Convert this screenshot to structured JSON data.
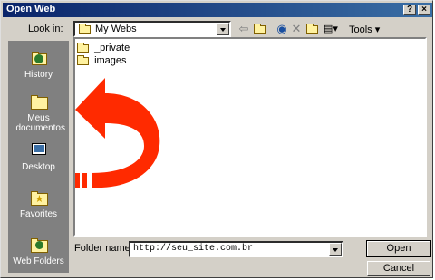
{
  "window": {
    "title": "Open Web",
    "help_label": "?",
    "close_label": "×"
  },
  "lookin": {
    "label": "Look in:",
    "value": "My Webs"
  },
  "toolbar": {
    "tools_label": "Tools ▾"
  },
  "places": [
    {
      "label": "History",
      "icon": "history-icon"
    },
    {
      "label": "Meus documentos",
      "icon": "my-documents-icon"
    },
    {
      "label": "Desktop",
      "icon": "desktop-icon"
    },
    {
      "label": "Favorites",
      "icon": "favorites-icon"
    },
    {
      "label": "Web Folders",
      "icon": "web-folders-icon"
    }
  ],
  "files": [
    {
      "name": "_private"
    },
    {
      "name": "images"
    }
  ],
  "filename": {
    "label": "Folder name:",
    "value": "http://seu_site.com.br"
  },
  "buttons": {
    "open": "Open",
    "cancel": "Cancel"
  },
  "colors": {
    "arrow": "#ff2a00",
    "titlebar": "#0a246a",
    "places_bg": "#808080"
  }
}
